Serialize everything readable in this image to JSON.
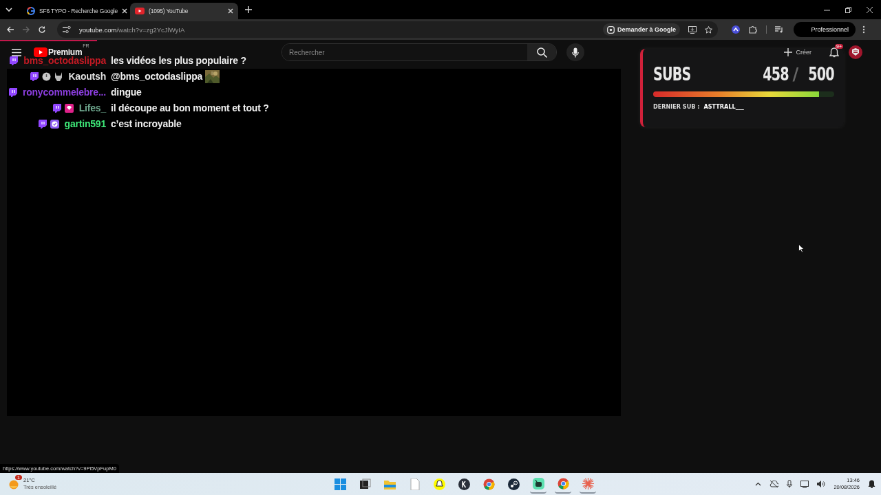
{
  "browser": {
    "tabs": [
      {
        "title": "SF6 TYPO - Recherche Google",
        "kind": "google",
        "selected": false
      },
      {
        "title": "(1095) YouTube",
        "kind": "youtube",
        "selected": true
      }
    ],
    "address": {
      "host": "youtube.com",
      "path": "/watch?v=zg2YcJlWyIA"
    },
    "ask_google": "Demander à Google",
    "profile": "Professionnel",
    "forward_disabled": true
  },
  "youtube": {
    "logo": "Premium",
    "region": "FR",
    "search": {
      "placeholder": "Rechercher"
    },
    "create": "Créer",
    "notifications": "9+",
    "progress": {
      "level": 0.11
    }
  },
  "chat": [
    {
      "user": "bms_octodaslippa",
      "color": "#c41a24",
      "badges": [
        {
          "kind": "twitch"
        }
      ],
      "message": "les vidéos les plus populaire ?",
      "emote": false
    },
    {
      "user": "Kaoutsh",
      "color": "#e0e0e0",
      "badges": [
        {
          "kind": "twitch"
        },
        {
          "kind": "clock"
        },
        {
          "kind": "horns"
        }
      ],
      "message": "@bms_octodaslippa",
      "emote": true
    },
    {
      "user": "ronycommelebre...",
      "color": "#8c3ee0",
      "badges": [
        {
          "kind": "twitch"
        }
      ],
      "message": "dingue",
      "emote": false
    },
    {
      "user": "Lifes_",
      "color": "#6fa88f",
      "badges": [
        {
          "kind": "twitch"
        },
        {
          "kind": "gem"
        }
      ],
      "message": "il découpe au bon moment et tout ?",
      "emote": false
    },
    {
      "user": "gartin591",
      "color": "#3ee878",
      "badges": [
        {
          "kind": "twitch"
        },
        {
          "kind": "verified"
        }
      ],
      "message": "c’est incroyable",
      "emote": false
    }
  ],
  "subs_widget": {
    "title": "SUBS",
    "current": "458",
    "separator": "/",
    "goal": "500",
    "level": 0.915,
    "last_label": "DERNIER SUB :",
    "last_name": "ASTTRALL___"
  },
  "status_url": "https://www.youtube.com/watch?v=9Pi5VpFupM0",
  "taskbar": {
    "weather": {
      "temp": "21°C",
      "text": "Très ensoleillé",
      "badge": "1"
    },
    "apps": [
      {
        "kind": "windows",
        "active": false
      },
      {
        "kind": "taskview",
        "active": false
      },
      {
        "kind": "folder",
        "active": false
      },
      {
        "kind": "file",
        "active": false
      },
      {
        "kind": "snapchat",
        "active": false
      },
      {
        "kind": "k4",
        "active": false
      },
      {
        "kind": "chrome",
        "active": false
      },
      {
        "kind": "steam",
        "active": false
      },
      {
        "kind": "greenapp",
        "active": true
      },
      {
        "kind": "chrome",
        "active": true
      },
      {
        "kind": "sparkle",
        "active": true
      }
    ],
    "time": "13:46",
    "date": "20/08/2026"
  }
}
